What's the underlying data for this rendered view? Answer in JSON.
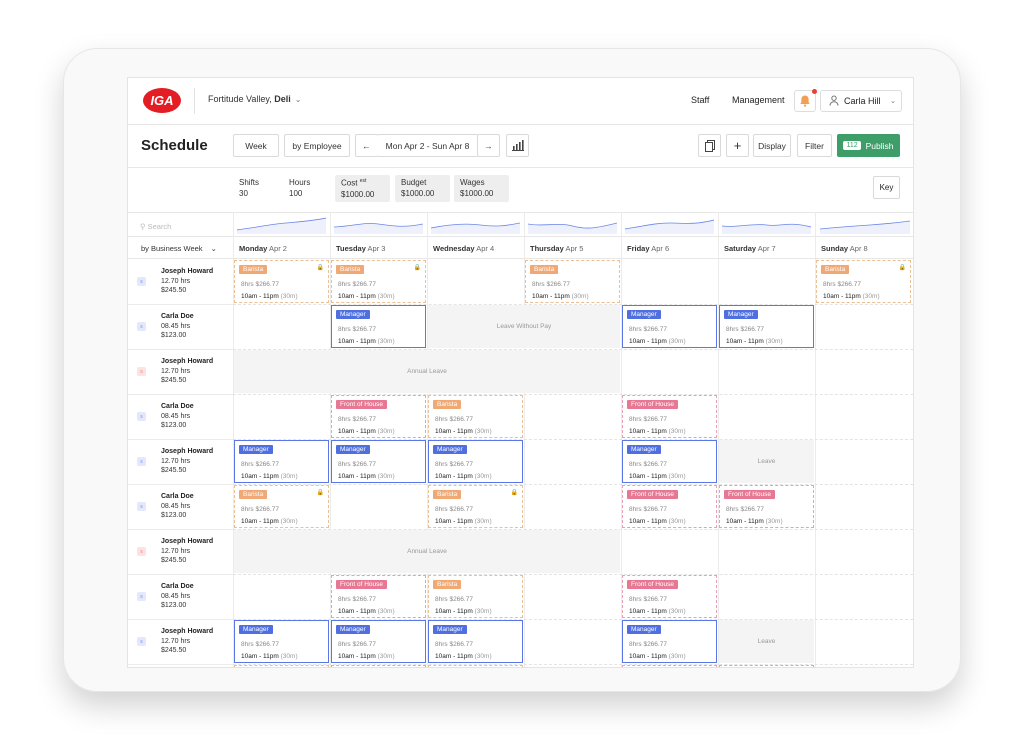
{
  "nav": {
    "location": "Fortitude Valley, ",
    "location_bold": "Deli",
    "staff": "Staff",
    "management": "Management",
    "user": "Carla Hill"
  },
  "toolbar": {
    "title": "Schedule",
    "week": "Week",
    "by_employee": "by Employee",
    "date_range": "Mon Apr 2 - Sun Apr 8",
    "display": "Display",
    "filter": "Filter",
    "publish_count": "112",
    "publish": "Publish"
  },
  "stats": {
    "shifts_label": "Shifts",
    "shifts": "30",
    "hours_label": "Hours",
    "hours": "100",
    "cost_label": "Cost",
    "cost_sup": "est",
    "cost": "$1000.00",
    "budget_label": "Budget",
    "budget": "$1000.00",
    "wages_label": "Wages",
    "wages": "$1000.00",
    "key": "Key"
  },
  "grid": {
    "search_placeholder": "Search",
    "business_week": "by Business Week",
    "days": [
      {
        "name": "Monday",
        "date": "Apr 2"
      },
      {
        "name": "Tuesday",
        "date": "Apr 3"
      },
      {
        "name": "Wednesday",
        "date": "Apr 4"
      },
      {
        "name": "Thursday",
        "date": "Apr 5"
      },
      {
        "name": "Friday",
        "date": "Apr 6"
      },
      {
        "name": "Saturday",
        "date": "Apr 7"
      },
      {
        "name": "Sunday",
        "date": "Apr 8"
      }
    ]
  },
  "employees": [
    {
      "name": "Joseph Howard",
      "hours": "12.70 hrs",
      "cost": "$245.50",
      "badge": "s",
      "badge_color": "#7b8ef0"
    },
    {
      "name": "Carla Doe",
      "hours": "08.45 hrs",
      "cost": "$123.00",
      "badge": "s",
      "badge_color": "#7b8ef0"
    },
    {
      "name": "Joseph Howard",
      "hours": "12.70 hrs",
      "cost": "$245.50",
      "badge": "s",
      "badge_color": "#e8807f"
    },
    {
      "name": "Carla Doe",
      "hours": "08.45 hrs",
      "cost": "$123.00",
      "badge": "s",
      "badge_color": "#7b8ef0"
    },
    {
      "name": "Joseph Howard",
      "hours": "12.70 hrs",
      "cost": "$245.50",
      "badge": "s",
      "badge_color": "#7b8ef0"
    },
    {
      "name": "Carla Doe",
      "hours": "08.45 hrs",
      "cost": "$123.00",
      "badge": "s",
      "badge_color": "#7b8ef0"
    },
    {
      "name": "Joseph Howard",
      "hours": "12.70 hrs",
      "cost": "$245.50",
      "badge": "s",
      "badge_color": "#e8807f"
    },
    {
      "name": "Carla Doe",
      "hours": "08.45 hrs",
      "cost": "$123.00",
      "badge": "s",
      "badge_color": "#7b8ef0"
    },
    {
      "name": "Joseph Howard",
      "hours": "12.70 hrs",
      "cost": "$245.50",
      "badge": "s",
      "badge_color": "#7b8ef0"
    }
  ],
  "shift_text": {
    "barista": "Barista",
    "manager": "Manager",
    "front": "Front of House",
    "pay": "8hrs  $266.77",
    "time": "10am - 11pm",
    "break": "(30m)"
  },
  "leave_text": {
    "lwp": "Leave Without Pay",
    "annual": "Annual Leave",
    "leave": "Leave"
  },
  "colors": {
    "publish": "#3e9e6a",
    "barista": "#f0a874",
    "manager": "#4f6fe0",
    "front_of_house": "#e77894",
    "sparkline": "#6a86e8"
  }
}
